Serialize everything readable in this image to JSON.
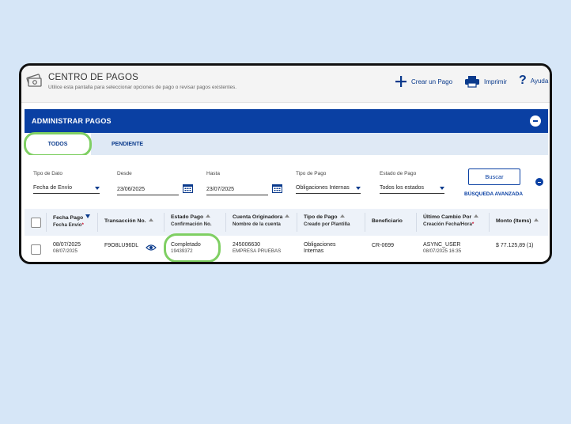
{
  "header": {
    "title": "CENTRO DE PAGOS",
    "subtitle": "Utilice esta pantalla para seleccionar opciones de pago o revisar pagos existentes.",
    "create_label": "Crear un Pago",
    "print_label": "Imprimir",
    "help_label": "Ayuda"
  },
  "section": {
    "title": "ADMINISTRAR PAGOS"
  },
  "tabs": [
    {
      "label": "TODOS"
    },
    {
      "label": "PENDIENTE"
    }
  ],
  "filters": {
    "data_type": {
      "label": "Tipo de Dato",
      "value": "Fecha de Envío"
    },
    "from": {
      "label": "Desde",
      "value": "23/06/2025"
    },
    "to": {
      "label": "Hasta",
      "value": "23/07/2025"
    },
    "payment_type": {
      "label": "Tipo de Pago",
      "value": "Obligaciones Internas"
    },
    "payment_state": {
      "label": "Estado de Pago",
      "value": "Todos los estados"
    },
    "search_label": "Buscar",
    "advanced_label": "BÚSQUEDA AVANZADA"
  },
  "table": {
    "columns": {
      "fecha_pago": "Fecha Pago",
      "fecha_envio": "Fecha Envío",
      "req": "*",
      "transaccion": "Transacción No.",
      "estado": "Estado Pago",
      "confirmacion": "Confirmación No.",
      "cuenta": "Cuenta Originadora",
      "nombre_cuenta": "Nombre de la cuenta",
      "tipo_pago": "Tipo de Pago",
      "plantilla": "Creado por Plantilla",
      "beneficiario": "Beneficiario",
      "ultimo_cambio": "Último Cambio Por",
      "creacion": "Creación Fecha/Hora",
      "monto": "Monto (Items)"
    },
    "rows": [
      {
        "fecha_pago": "08/07/2025",
        "fecha_envio": "08/07/2025",
        "transaccion": "F9O8LU96DL",
        "estado": "Completado",
        "confirmacion": "19439372",
        "cuenta": "245006630",
        "nombre_cuenta": "EMPRESA PRUEBAS",
        "tipo_pago_1": "Obligaciones",
        "tipo_pago_2": "Internas",
        "beneficiario": "CR-0699",
        "ultimo_cambio": "ASYNC_USER",
        "creacion": "08/07/2025 16:35",
        "monto": "$ 77.125,89 (1)"
      }
    ]
  },
  "colors": {
    "brand_blue": "#0a40a3",
    "highlight_green": "#7fcf63",
    "background": "#d6e6f7"
  }
}
